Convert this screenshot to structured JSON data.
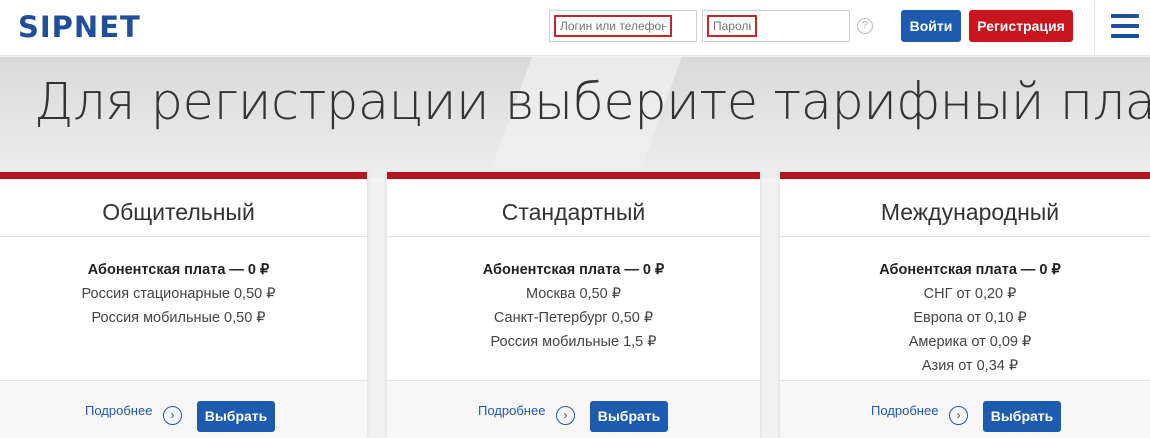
{
  "header": {
    "logo": "SIPNET",
    "login_placeholder": "Логин или телефон",
    "password_placeholder": "Пароль",
    "help_symbol": "?",
    "login_button": "Войти",
    "register_button": "Регистрация"
  },
  "hero": {
    "title": "Для регистрации выберите тарифный план"
  },
  "plans": [
    {
      "name": "Общительный",
      "fee": "Абонентская плата — 0 ₽",
      "rates": [
        "Россия стационарные 0,50 ₽",
        "Россия мобильные 0,50 ₽"
      ],
      "more": "Подробнее",
      "select": "Выбрать"
    },
    {
      "name": "Стандартный",
      "fee": "Абонентская плата — 0 ₽",
      "rates": [
        "Москва 0,50 ₽",
        "Санкт-Петербург 0,50 ₽",
        "Россия мобильные 1,5 ₽"
      ],
      "more": "Подробнее",
      "select": "Выбрать"
    },
    {
      "name": "Международный",
      "fee": "Абонентская плата — 0 ₽",
      "rates": [
        "СНГ от 0,20 ₽",
        "Европа от 0,10 ₽",
        "Америка от 0,09 ₽",
        "Азия от 0,34 ₽"
      ],
      "more": "Подробнее",
      "select": "Выбрать"
    }
  ],
  "colors": {
    "brand_blue": "#1f4f9c",
    "button_blue": "#1c5bad",
    "register_red": "#c9151e",
    "card_accent": "#b3161e"
  },
  "icons": {
    "more": "chevron-right-circle-icon",
    "help": "question-circle-icon",
    "menu": "hamburger-menu-icon"
  }
}
